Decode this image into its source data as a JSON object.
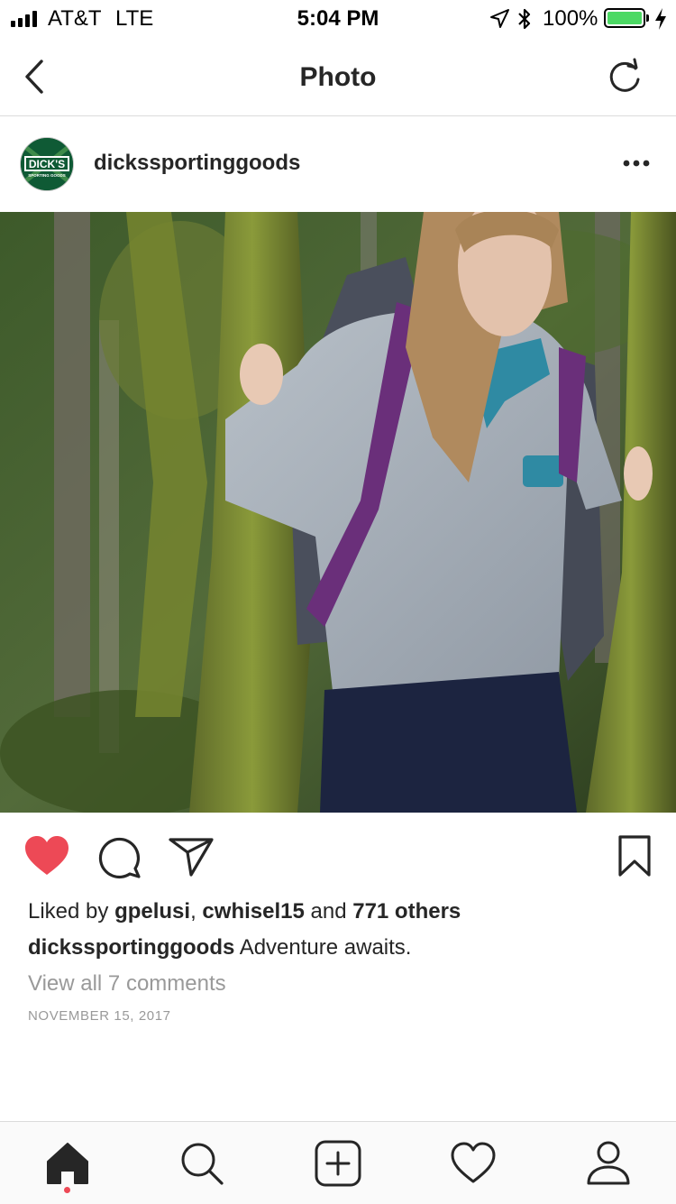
{
  "status_bar": {
    "carrier": "AT&T",
    "network": "LTE",
    "time": "5:04 PM",
    "battery_percent": "100%",
    "battery_level": 1.0,
    "icons": [
      "signal-icon",
      "location-arrow-icon",
      "bluetooth-icon",
      "battery-icon",
      "charging-bolt-icon"
    ],
    "battery_color": "#4cd964"
  },
  "header": {
    "title": "Photo",
    "back_icon": "chevron-left-icon",
    "refresh_icon": "refresh-icon"
  },
  "post": {
    "username": "dickssportinggoods",
    "avatar_logo_text": "DICK'S",
    "avatar_logo_subtext": "SPORTING GOODS",
    "more_icon": "more-dots-icon",
    "liked": true,
    "like_color": "#ed4956",
    "likes": {
      "prefix": "Liked by",
      "user1": "gpelusi",
      "separator": ",",
      "user2": "cwhisel15",
      "conjunction": "and",
      "others": "771 others"
    },
    "caption": {
      "username": "dickssportinggoods",
      "text": "Adventure awaits."
    },
    "view_comments": "View all 7 comments",
    "date": "NOVEMBER 15, 2017"
  },
  "tab_bar": {
    "items": [
      "home-icon",
      "search-icon",
      "add-post-icon",
      "activity-heart-icon",
      "profile-icon"
    ],
    "active": "home-icon",
    "notification_dot_color": "#ed4956"
  }
}
